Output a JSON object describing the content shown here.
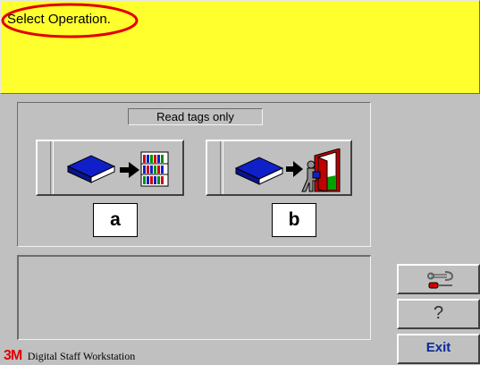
{
  "message": {
    "text": "Select Operation."
  },
  "operations": {
    "mode_label": "Read tags only",
    "buttons": [
      {
        "key": "a",
        "icon": "book-to-shelf-icon"
      },
      {
        "key": "b",
        "icon": "book-to-door-icon"
      }
    ]
  },
  "side_buttons": {
    "tools_icon": "wrench-screwdriver-icon",
    "help_label": "?",
    "exit_label": "Exit"
  },
  "footer": {
    "logo": "3M",
    "product": "Digital Staff Workstation"
  },
  "colors": {
    "message_bg": "#ffff2e",
    "background": "#c0c0c0",
    "book_blue": "#1020c8",
    "exit_blue": "#0a2a9a",
    "logo_red": "#e00000",
    "annotation_red": "#e00000"
  }
}
